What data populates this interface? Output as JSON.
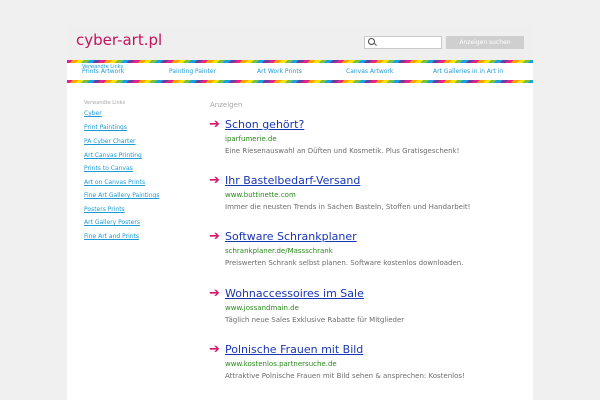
{
  "header": {
    "domain": "cyber-art.pl",
    "search_button": "Anzeigen suchen",
    "search_value": ""
  },
  "topnav": {
    "title": "Verwandte Links",
    "links": [
      "Prints Artwork",
      "Painting Painter",
      "Art Work Prints",
      "Canvas Artwork",
      "Art Galleries in in Art in"
    ]
  },
  "sidebar": {
    "title": "Verwandte Links",
    "links": [
      "Cyber",
      "Print Paintings",
      "PA Cyber Charter",
      "Art Canvas Printing",
      "Prints to Canvas",
      "Art on Canvas Prints",
      "Fine Art Gallery Paintings",
      "Posters Prints",
      "Art Gallery Posters",
      "Fine Art and Prints"
    ]
  },
  "ads": {
    "title": "Anzeigen",
    "items": [
      {
        "title": "Schon gehört?",
        "url": "iparfumerie.de",
        "desc": "Eine Riesenauswahl an Düften und Kosmetik. Plus Gratisgeschenk!"
      },
      {
        "title": "Ihr Bastelbedarf-Versand",
        "url": "www.buttinette.com",
        "desc": "Immer die neusten Trends in Sachen Basteln, Stoffen und Handarbeit!"
      },
      {
        "title": "Software Schrankplaner",
        "url": "schrankplaner.de/Massschrank",
        "desc": "Preiswerten Schrank selbst planen. Software kostenlos downloaden."
      },
      {
        "title": "Wohnaccessoires im Sale",
        "url": "www.jossandmain.de",
        "desc": "Täglich neue Sales Exklusive Rabatte für Mitglieder"
      },
      {
        "title": "Polnische Frauen mit Bild",
        "url": "www.kostenlos.partnersuche.de",
        "desc": "Attraktive Polnische Frauen mit Bild sehen & ansprechen: Kostenlos!"
      }
    ]
  },
  "colors": {
    "domain": "#c2145c",
    "link": "#1c9ad6",
    "ad_title": "#1b36b4",
    "ad_url": "#2b8a1d",
    "arrow": "#d7166d"
  }
}
